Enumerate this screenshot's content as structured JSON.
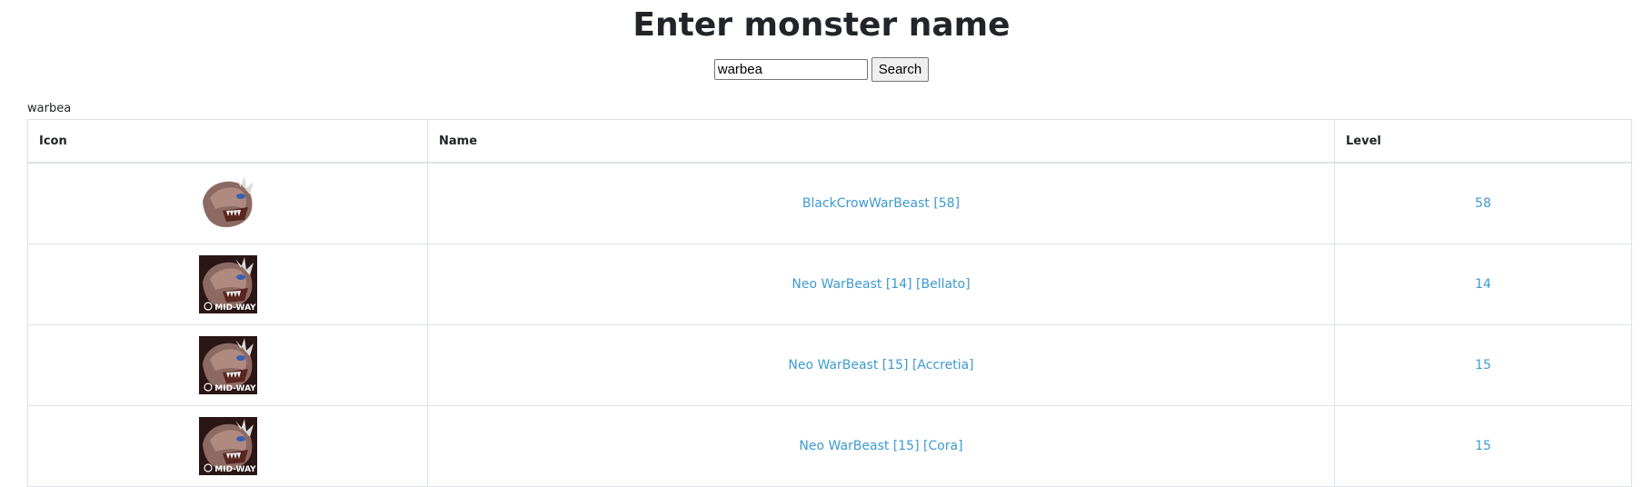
{
  "header": {
    "title": "Enter monster name"
  },
  "search": {
    "value": "warbea",
    "button_label": "Search"
  },
  "query_echo": "warbea",
  "table": {
    "columns": [
      "Icon",
      "Name",
      "Level"
    ],
    "rows": [
      {
        "icon": "warbeast-icon",
        "icon_caption": "",
        "name": "BlackCrowWarBeast [58]",
        "level": "58"
      },
      {
        "icon": "warbeast-icon",
        "icon_caption": "MID-WAY",
        "name": "Neo WarBeast [14] [Bellato]",
        "level": "14"
      },
      {
        "icon": "warbeast-icon",
        "icon_caption": "MID-WAY",
        "name": "Neo WarBeast [15] [Accretia]",
        "level": "15"
      },
      {
        "icon": "warbeast-icon",
        "icon_caption": "MID-WAY",
        "name": "Neo WarBeast [15] [Cora]",
        "level": "15"
      }
    ]
  },
  "colors": {
    "link": "#3d9ad1",
    "border": "#dee2e6",
    "text": "#212529"
  }
}
